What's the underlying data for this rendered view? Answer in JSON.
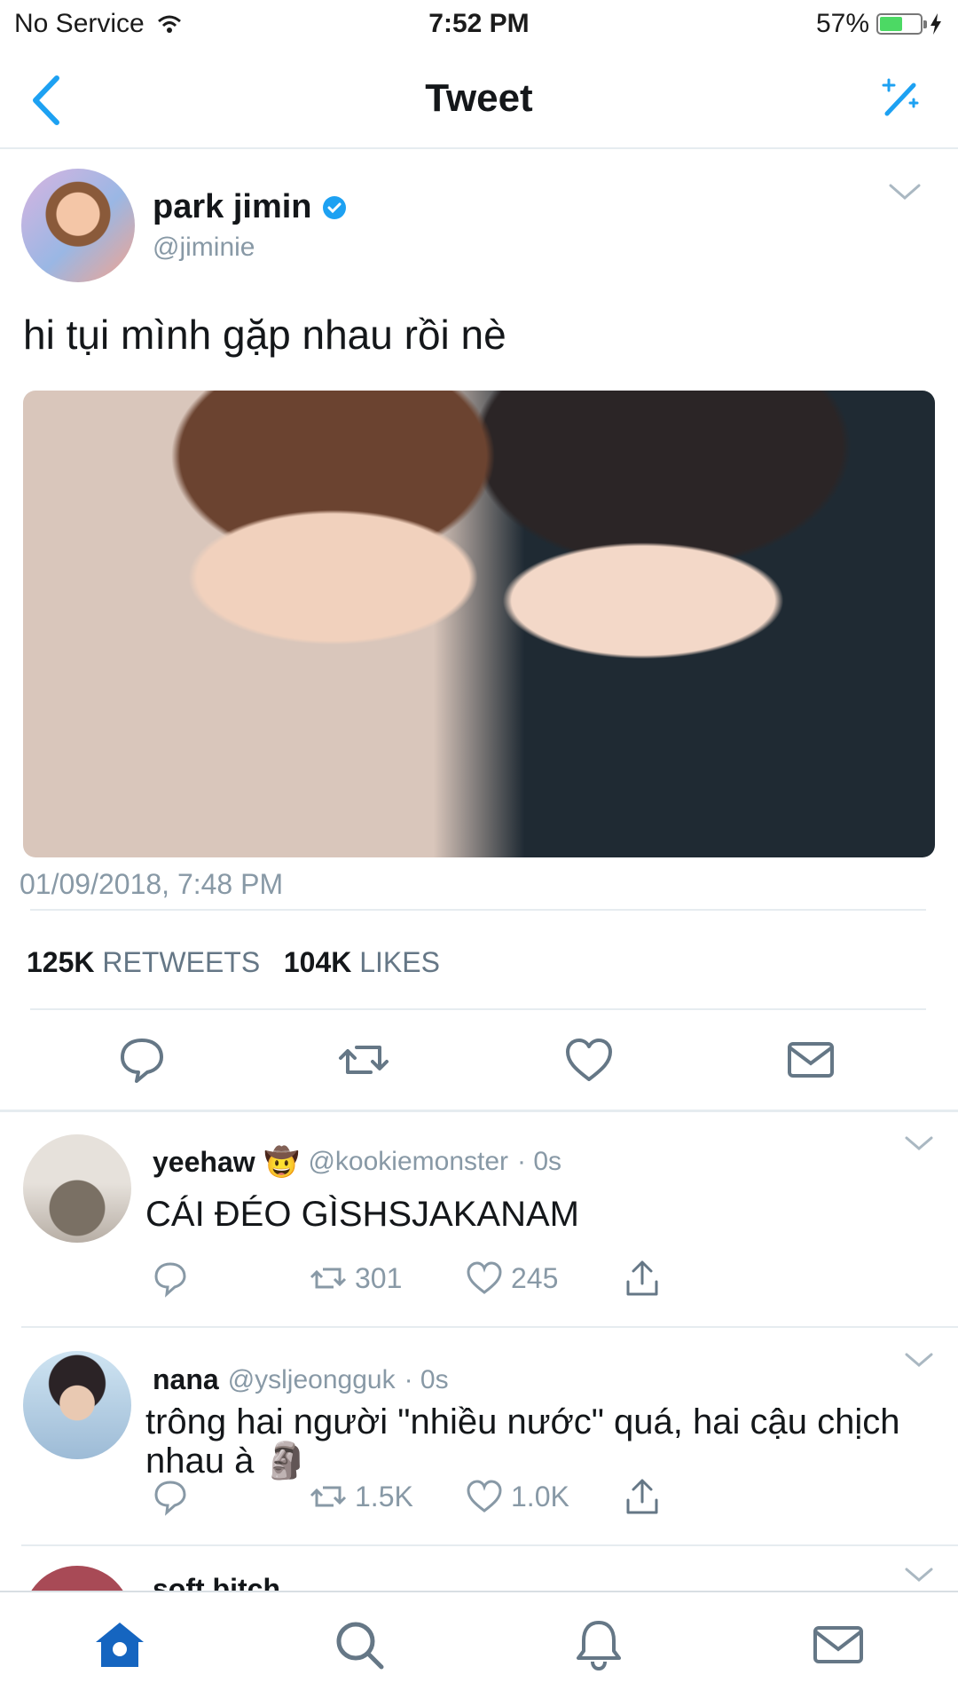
{
  "status_bar": {
    "carrier": "No Service",
    "time": "7:52 PM",
    "battery": "57%",
    "battery_level": 0.57
  },
  "nav": {
    "title": "Tweet"
  },
  "tweet": {
    "author_name": "park jimin",
    "author_handle": "@jiminie",
    "text": "hi tụi mình gặp nhau rồi nè",
    "timestamp": "01/09/2018, 7:48 PM",
    "retweets_count": "125K",
    "retweets_label": "RETWEETS",
    "likes_count": "104K",
    "likes_label": "LIKES"
  },
  "replies": [
    {
      "name": "yeehaw",
      "emoji": "🤠",
      "handle": "@kookiemonster",
      "time": "· 0s",
      "text": "CÁI ĐÉO GÌSHSJAKANAM",
      "retweets": "301",
      "likes": "245"
    },
    {
      "name": "nana",
      "handle": "@ysljeongguk",
      "time": "· 0s",
      "text": "trông hai người \"nhiều nước\" quá, hai cậu chịch nhau à 🗿",
      "retweets": "1.5K",
      "likes": "1.0K"
    }
  ],
  "partial_reply": {
    "text": "soft bitch"
  },
  "colors": {
    "accent": "#1da1f2",
    "tab_home": "#1565c0",
    "secondary_text": "#8899a6"
  },
  "icons": {
    "nav": [
      "back-chevron-icon",
      "compose-sparkle-icon"
    ],
    "actions": [
      "reply-icon",
      "retweet-icon",
      "like-icon",
      "message-icon",
      "share-icon"
    ],
    "tabs": [
      "home-icon",
      "search-icon",
      "notifications-icon",
      "messages-icon"
    ]
  }
}
